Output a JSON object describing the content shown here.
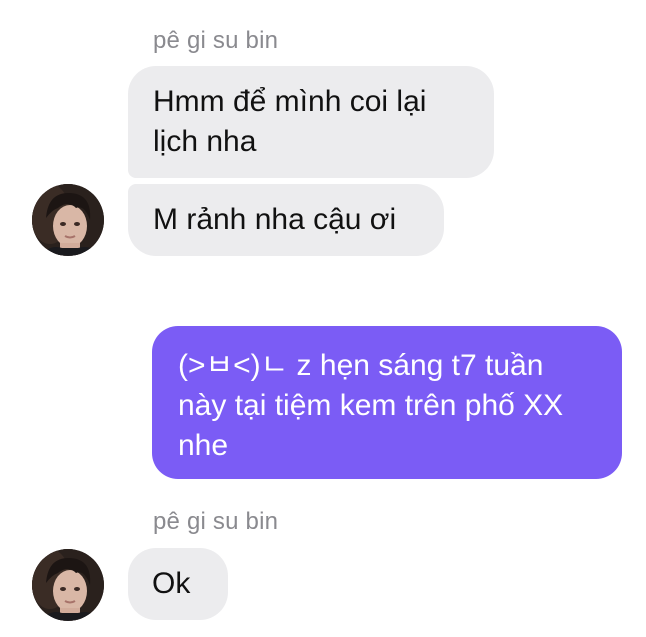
{
  "messages": [
    {
      "type": "sender",
      "name": "pê gi su bin"
    },
    {
      "type": "incoming",
      "text": "Hmm để mình coi lại lịch nha"
    },
    {
      "type": "incoming",
      "text": "M rảnh nha cậu ơi",
      "avatar": "avatar-photo-icon"
    },
    {
      "type": "outgoing",
      "text": "(>ㅂ<)ㄴ z hẹn sáng t7 tuần này tại tiệm kem trên phố XX nhe"
    },
    {
      "type": "sender",
      "name": "pê gi su bin"
    },
    {
      "type": "incoming",
      "text": "Ok",
      "avatar": "avatar-photo-icon"
    }
  ],
  "colors": {
    "incoming_bubble": "#ececee",
    "outgoing_bubble": "#7b5cf5",
    "sender_name": "#8a8a8f"
  }
}
